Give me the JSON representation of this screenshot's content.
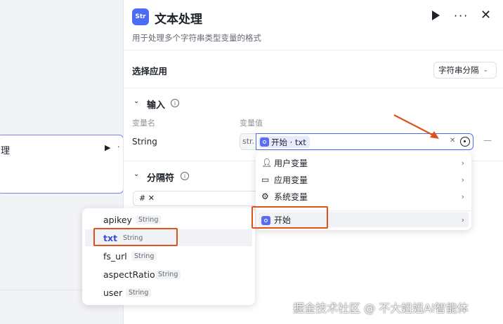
{
  "canvas": {
    "node_char": "理"
  },
  "header": {
    "app_icon_text": "Str",
    "title": "文本处理",
    "subtitle": "用于处理多个字符串类型变量的格式"
  },
  "select_app": {
    "label": "选择应用",
    "value": "字符串分隔"
  },
  "input_section": {
    "title": "输入",
    "col_name": "变量名",
    "col_value": "变量值",
    "row_name": "String",
    "prefix": "str.",
    "chip_label": "开始 · txt"
  },
  "separator_section": {
    "title": "分隔符",
    "tag": "#"
  },
  "dropdown_menu": {
    "items": [
      {
        "icon": "user-icon",
        "label": "用户变量"
      },
      {
        "icon": "folder-icon",
        "label": "应用变量"
      },
      {
        "icon": "gear-icon",
        "label": "系统变量"
      },
      {
        "icon": "start-icon",
        "label": "开始"
      }
    ]
  },
  "variable_list": {
    "items": [
      {
        "name": "apikey",
        "type": "String"
      },
      {
        "name": "txt",
        "type": "String"
      },
      {
        "name": "fs_url",
        "type": "String"
      },
      {
        "name": "aspectRatio",
        "type": "String"
      },
      {
        "name": "user",
        "type": "String"
      }
    ]
  },
  "watermark": "掘金技术社区 @ 不大姐姐AI智能体",
  "colors": {
    "accent": "#4d6cf4",
    "annotation": "#e0521c"
  }
}
